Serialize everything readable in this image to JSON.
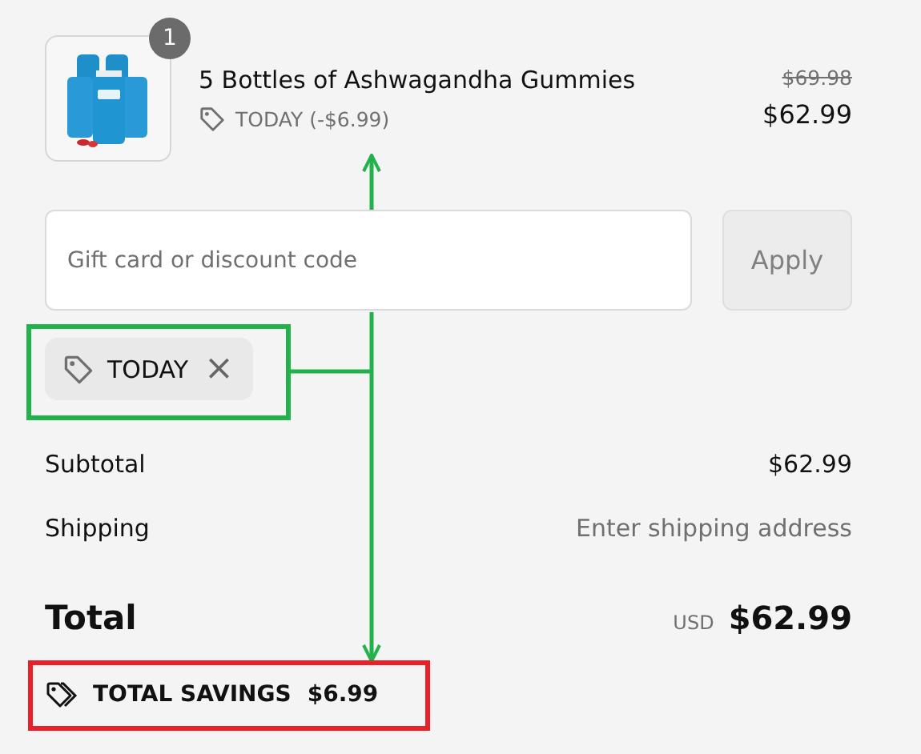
{
  "product": {
    "quantity": "1",
    "name": "5 Bottles of Ashwagandha Gummies",
    "discount": "TODAY (-$6.99)",
    "original_price": "$69.98",
    "price": "$62.99"
  },
  "discount_form": {
    "placeholder": "Gift card or discount code",
    "button": "Apply"
  },
  "applied_codes": [
    {
      "code": "TODAY",
      "remove": "×"
    }
  ],
  "summary": [
    {
      "label": "Subtotal",
      "value": "$62.99",
      "kind": "amount"
    },
    {
      "label": "Shipping",
      "value": "Enter shipping address",
      "kind": "hint"
    }
  ],
  "total": {
    "label": "Total",
    "currency": "USD",
    "value": "$62.99"
  },
  "savings": {
    "label": "TOTAL SAVINGS",
    "value": "$6.99"
  }
}
